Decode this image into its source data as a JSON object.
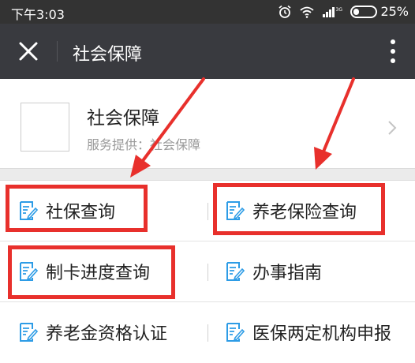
{
  "status_bar": {
    "time": "下午3:03",
    "battery": "25%",
    "battery_level": 0.25
  },
  "header": {
    "title": "社会保障"
  },
  "service_card": {
    "title": "社会保障",
    "subtitle": "服务提供：社会保障"
  },
  "menu": {
    "rows": [
      {
        "left": "社保查询",
        "right": "养老保险查询"
      },
      {
        "left": "制卡进度查询",
        "right": "办事指南"
      },
      {
        "left": "养老金资格认证",
        "right": "医保两定机构申报"
      }
    ]
  },
  "colors": {
    "header_bg": "#393a3f",
    "status_bg": "#333333",
    "highlight": "#e8302c",
    "icon_blue": "#2d9ce6"
  },
  "icons": [
    "close-icon",
    "more-icon",
    "chevron-right-icon",
    "document-edit-icon",
    "alarm-icon",
    "wifi-icon",
    "signal-icon",
    "battery-icon"
  ]
}
